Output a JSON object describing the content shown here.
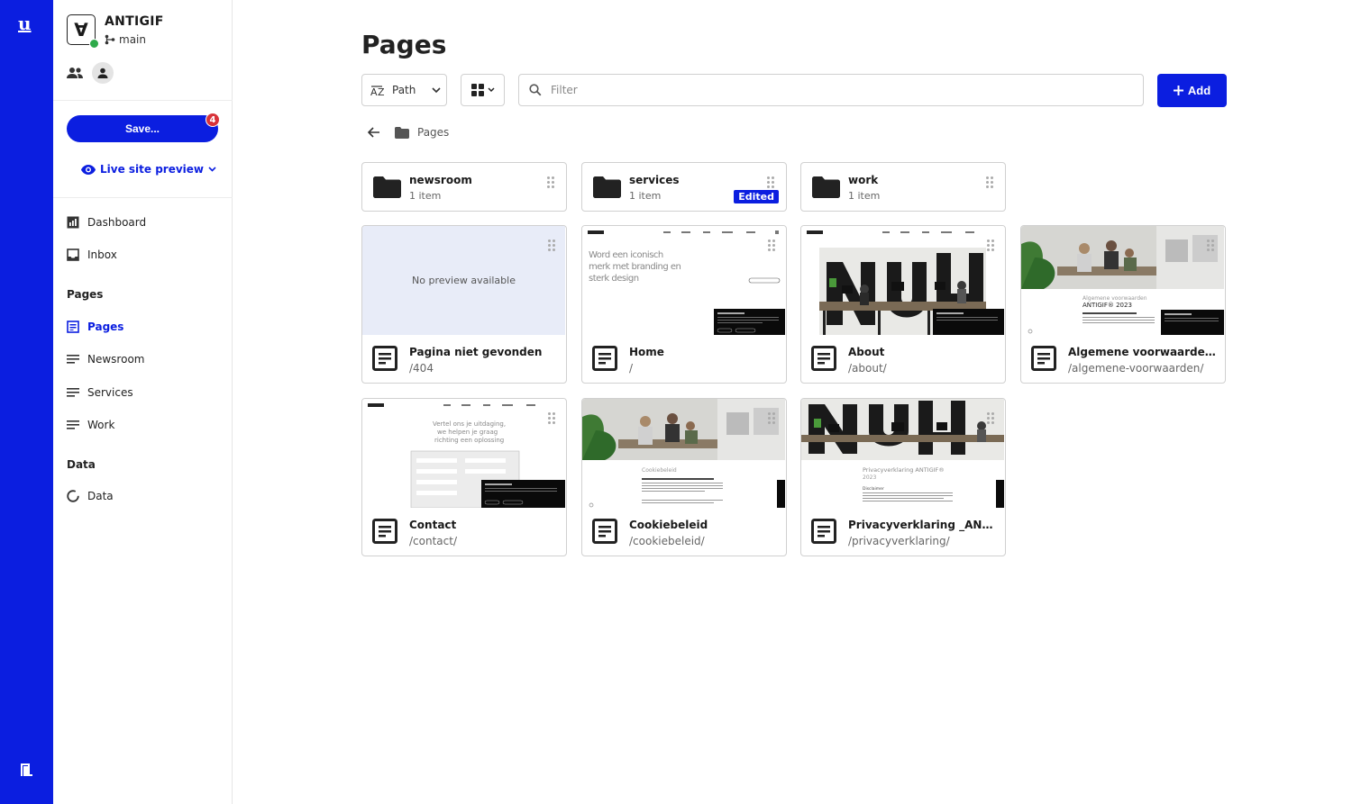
{
  "rail": {
    "logo": "u"
  },
  "sidebar": {
    "project_name": "ANTIGIF",
    "branch": "main",
    "save_label": "Save...",
    "save_badge": "4",
    "live_preview": "Live site preview",
    "nav": [
      {
        "label": "Dashboard",
        "icon": "dashboard-icon"
      },
      {
        "label": "Inbox",
        "icon": "inbox-icon"
      }
    ],
    "pages_heading": "Pages",
    "pages": [
      {
        "label": "Pages",
        "icon": "pages-icon",
        "active": true
      },
      {
        "label": "Newsroom",
        "icon": "list-icon"
      },
      {
        "label": "Services",
        "icon": "list-icon"
      },
      {
        "label": "Work",
        "icon": "list-icon"
      }
    ],
    "data_heading": "Data",
    "data": [
      {
        "label": "Data",
        "icon": "data-icon"
      }
    ]
  },
  "main": {
    "title": "Pages",
    "sort_label": "Path",
    "filter_placeholder": "Filter",
    "add_label": "Add",
    "breadcrumb": "Pages",
    "folders": [
      {
        "name": "newsroom",
        "count": "1 item",
        "edited": false
      },
      {
        "name": "services",
        "count": "1 item",
        "edited": true,
        "edited_label": "Edited"
      },
      {
        "name": "work",
        "count": "1 item",
        "edited": false
      }
    ],
    "no_preview": "No preview available",
    "pages": [
      {
        "name": "Pagina niet gevonden",
        "path": "/404",
        "preview": "none"
      },
      {
        "name": "Home",
        "path": "/",
        "preview": "home",
        "headline": [
          "Word een iconisch",
          "merk met branding en",
          "sterk design"
        ]
      },
      {
        "name": "About",
        "path": "/about/",
        "preview": "office"
      },
      {
        "name": "Algemene voorwaarden _A...",
        "path": "/algemene-voorwaarden/",
        "preview": "terms"
      },
      {
        "name": "Contact",
        "path": "/contact/",
        "preview": "contact"
      },
      {
        "name": "Cookiebeleid",
        "path": "/cookiebeleid/",
        "preview": "cookie"
      },
      {
        "name": "Privacyverklaring _ANTIGIF...",
        "path": "/privacyverklaring/",
        "preview": "privacy"
      }
    ]
  }
}
